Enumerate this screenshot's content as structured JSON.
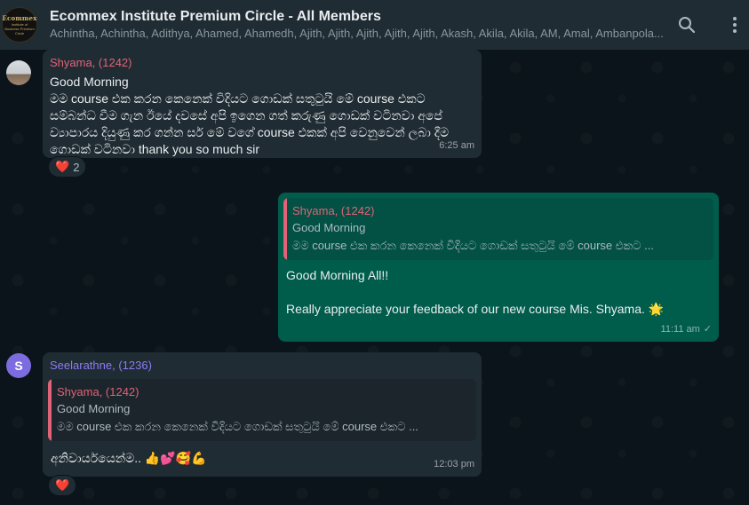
{
  "header": {
    "group_name": "Ecommex Institute Premium Circle - All Members",
    "members": "Achintha, Achintha, Adithya, Ahamed, Ahamedh, Ajith, Ajith, Ajith, Ajith, Ajith, Akash, Akila, Akila, AM, Amal, Ambanpola...",
    "logo_line1": "Ecommex",
    "logo_line2": "Institute of Business Premium Circle",
    "icons": [
      "search-icon",
      "more-vertical-icon"
    ]
  },
  "messages": [
    {
      "sender": "Shyama, (1242)",
      "sender_color": "#e06377",
      "greeting": "Good Morning",
      "body": "මම course එක කරන කෙනෙක් විදියට ගොඩක් සතුටුයි මේ course එකට සම්බන්ධ වීම ගැන ඊයේ දවසේ අපි ඉගෙන ගත් කරුණු ගොඩක් වටිනවා අපේ ව්‍යාපාරය දියුණු කර ගන්න සර් මේ වගේ course එකක් අපි වෙනුවෙන් ලබා දීම ගොඩක් වටිනවා thank you so much sir",
      "time": "6:25 am",
      "reaction": "❤️",
      "reaction_count": "2"
    },
    {
      "quote_sender": "Shyama, (1242)",
      "quote_greeting": "Good Morning",
      "quote_text": "මම course එක කරන කෙනෙක් විදියට ගොඩක් සතුටුයි මේ course එකට ...",
      "line1": "Good Morning All!!",
      "line2": "Really appreciate your feedback of our new course Mis. Shyama.",
      "emoji": "🌟",
      "time": "11:11 am",
      "status": "✓"
    },
    {
      "sender": "Seelarathne, (1236)",
      "sender_color": "#8b7cf6",
      "avatar_letter": "S",
      "quote_sender": "Shyama, (1242)",
      "quote_greeting": "Good Morning",
      "quote_text": "මම course එක කරන කෙනෙක් විදියට ගොඩක් සතුටුයි මේ course එකට ...",
      "body": "අනිවාර්යයෙන්ම.. 👍💕🥰💪",
      "time": "12:03 pm",
      "reaction": "❤️"
    }
  ],
  "colors": {
    "header_bg": "#202c33",
    "chat_bg": "#0b141a",
    "incoming_bubble": "#202c33",
    "outgoing_bubble": "#005c4b",
    "quote_accent": "#e06377"
  }
}
